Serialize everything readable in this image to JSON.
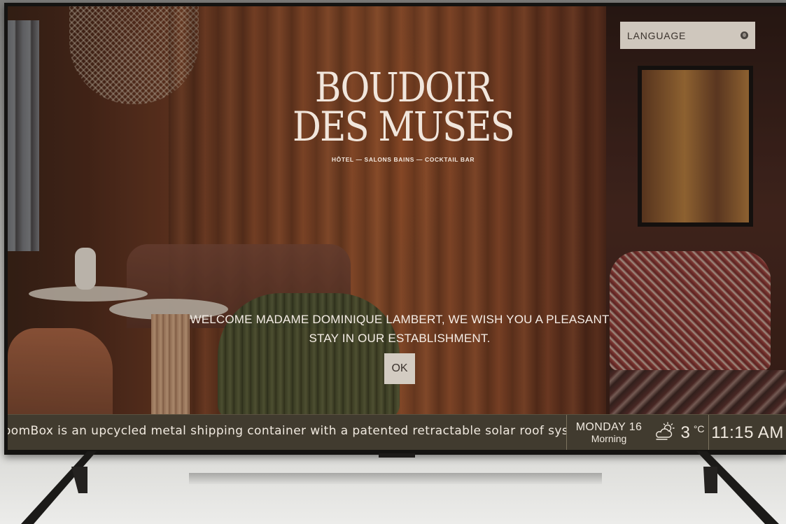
{
  "brand": {
    "line1": "BOUDOIR",
    "line2": "DES MUSES",
    "subtitle": "HÔTEL — SALONS BAINS — COCKTAIL BAR"
  },
  "language": {
    "label": "LANGUAGE",
    "icon": "globe-icon"
  },
  "welcome": {
    "message": "WELCOME MADAME DOMINIQUE LAMBERT, WE WISH YOU A PLEASANT STAY IN OUR ESTABLISHMENT.",
    "ok_label": "OK"
  },
  "bottom_bar": {
    "ticker": "oomBox is an upcycled metal shipping container with a patented retractable solar roof system th",
    "date_line": "MONDAY 16",
    "time_of_day": "Morning",
    "weather_icon": "partly-cloudy-sun-icon",
    "temperature": "3",
    "temperature_unit": "°C",
    "clock": "11:15 AM"
  },
  "colors": {
    "bar_background": "#413b2f",
    "button_background": "#d3ccc2",
    "text_light": "#f1e6dc"
  }
}
